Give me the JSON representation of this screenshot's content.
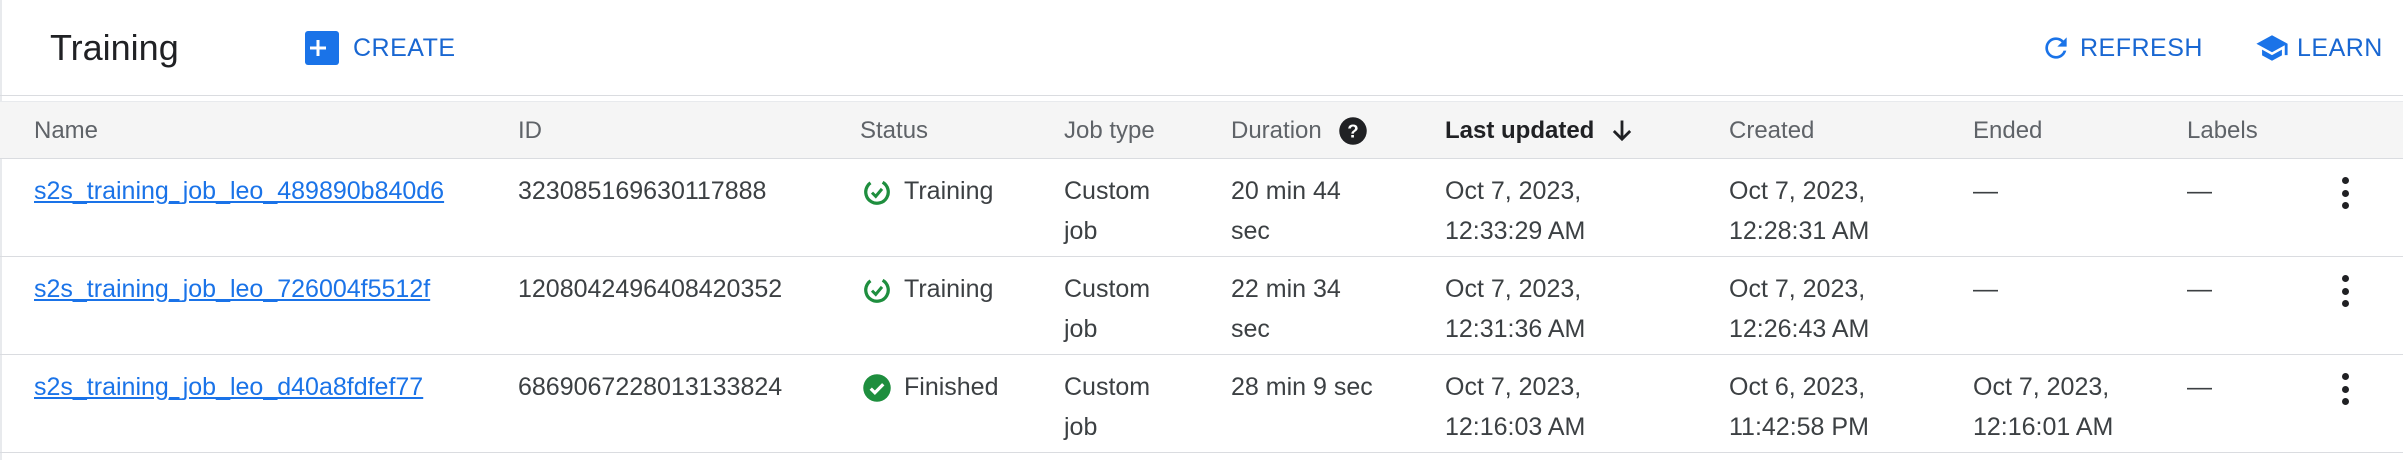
{
  "toolbar": {
    "title": "Training",
    "create_label": "CREATE",
    "refresh_label": "REFRESH",
    "learn_label": "LEARN"
  },
  "colors": {
    "accent": "#1a73e8",
    "status_green": "#1e8e3e",
    "header_bg": "#f5f5f5"
  },
  "table": {
    "columns": {
      "name": "Name",
      "id": "ID",
      "status": "Status",
      "job_type": "Job type",
      "duration": "Duration",
      "last_updated": "Last updated",
      "created": "Created",
      "ended": "Ended",
      "labels": "Labels"
    },
    "sort": {
      "column": "Last updated",
      "direction": "descending"
    },
    "rows": [
      {
        "name": "s2s_training_job_leo_489890b840d6",
        "id": "323085169630117888",
        "status": "Training",
        "status_icon": "training-progress-icon",
        "job_type_1": "Custom",
        "job_type_2": "job",
        "duration_1": "20 min 44",
        "duration_2": "sec",
        "last_updated_1": "Oct 7, 2023,",
        "last_updated_2": "12:33:29 AM",
        "created_1": "Oct 7, 2023,",
        "created_2": "12:28:31 AM",
        "ended_1": "—",
        "ended_2": "",
        "labels": "—"
      },
      {
        "name": "s2s_training_job_leo_726004f5512f",
        "id": "1208042496408420352",
        "status": "Training",
        "status_icon": "training-progress-icon",
        "job_type_1": "Custom",
        "job_type_2": "job",
        "duration_1": "22 min 34",
        "duration_2": "sec",
        "last_updated_1": "Oct 7, 2023,",
        "last_updated_2": "12:31:36 AM",
        "created_1": "Oct 7, 2023,",
        "created_2": "12:26:43 AM",
        "ended_1": "—",
        "ended_2": "",
        "labels": "—"
      },
      {
        "name": "s2s_training_job_leo_d40a8fdfef77",
        "id": "6869067228013133824",
        "status": "Finished",
        "status_icon": "check-circle-icon",
        "job_type_1": "Custom",
        "job_type_2": "job",
        "duration_1": "28 min 9 sec",
        "duration_2": "",
        "last_updated_1": "Oct 7, 2023,",
        "last_updated_2": "12:16:03 AM",
        "created_1": "Oct 6, 2023,",
        "created_2": "11:42:58 PM",
        "ended_1": "Oct 7, 2023,",
        "ended_2": "12:16:01 AM",
        "labels": "—"
      }
    ]
  }
}
